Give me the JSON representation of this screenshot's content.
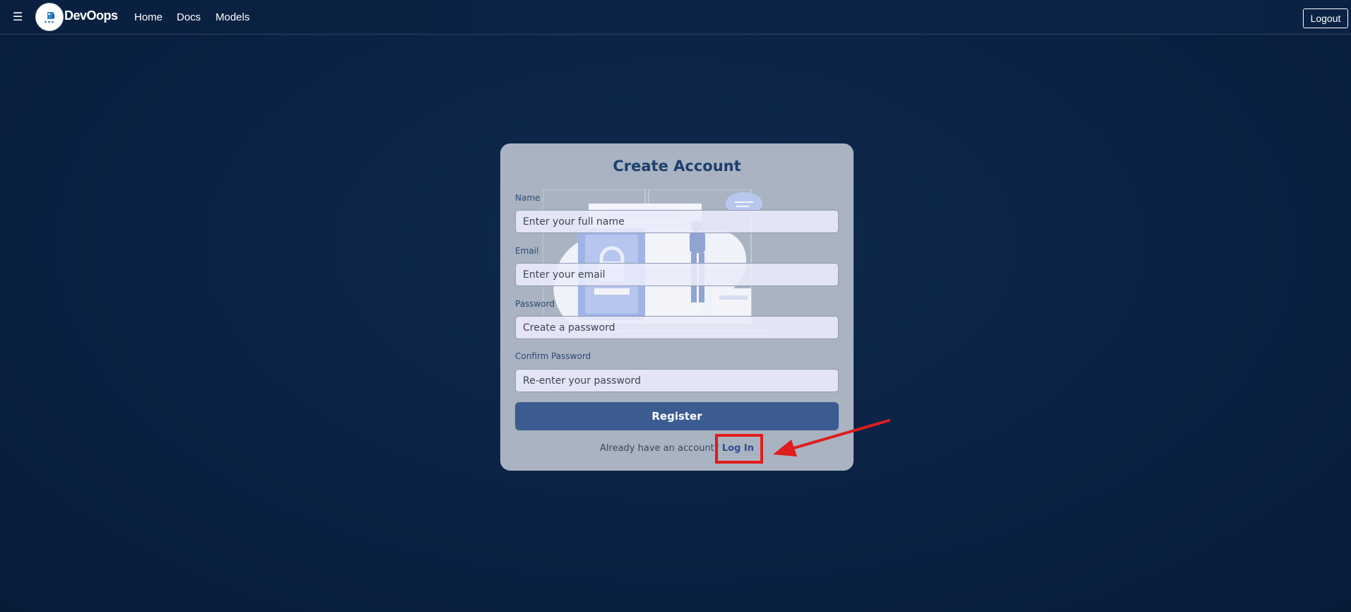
{
  "navbar": {
    "menu_icon": "☰",
    "brand": "DevOops",
    "links": [
      {
        "label": "Home"
      },
      {
        "label": "Docs"
      },
      {
        "label": "Models"
      }
    ],
    "logout_label": "Logout"
  },
  "form": {
    "title": "Create Account",
    "fields": [
      {
        "label": "Name",
        "placeholder": "Enter your full name",
        "value": ""
      },
      {
        "label": "Email",
        "placeholder": "Enter your email",
        "value": ""
      },
      {
        "label": "Password",
        "placeholder": "Create a password",
        "value": ""
      },
      {
        "label": "Confirm Password",
        "placeholder": "Re-enter your password",
        "value": ""
      }
    ],
    "register_label": "Register",
    "login_prompt": "Already have an account?",
    "login_link": "Log In"
  },
  "colors": {
    "background": "#0b2346",
    "card": "#aab3c1",
    "title": "#1d3f6e",
    "button": "#3c5b90",
    "annotation": "#e01c1c"
  },
  "icons": {
    "menu": "hamburger-icon",
    "logo": "devoops-logo",
    "annotation_arrow": "arrow-icon"
  }
}
